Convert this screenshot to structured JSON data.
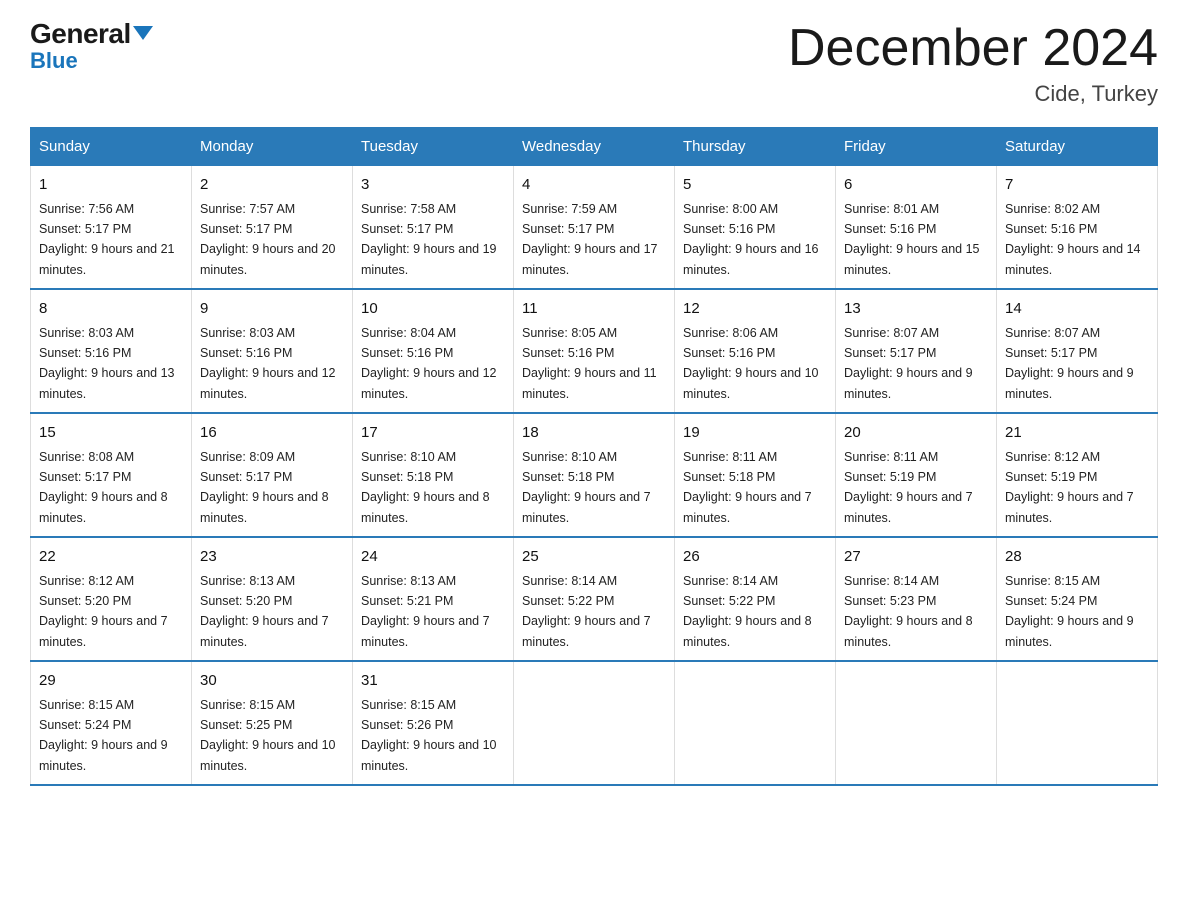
{
  "header": {
    "logo_top": "General",
    "logo_bottom": "Blue",
    "month_title": "December 2024",
    "location": "Cide, Turkey"
  },
  "weekdays": [
    "Sunday",
    "Monday",
    "Tuesday",
    "Wednesday",
    "Thursday",
    "Friday",
    "Saturday"
  ],
  "weeks": [
    [
      {
        "day": "1",
        "sunrise": "7:56 AM",
        "sunset": "5:17 PM",
        "daylight": "9 hours and 21 minutes."
      },
      {
        "day": "2",
        "sunrise": "7:57 AM",
        "sunset": "5:17 PM",
        "daylight": "9 hours and 20 minutes."
      },
      {
        "day": "3",
        "sunrise": "7:58 AM",
        "sunset": "5:17 PM",
        "daylight": "9 hours and 19 minutes."
      },
      {
        "day": "4",
        "sunrise": "7:59 AM",
        "sunset": "5:17 PM",
        "daylight": "9 hours and 17 minutes."
      },
      {
        "day": "5",
        "sunrise": "8:00 AM",
        "sunset": "5:16 PM",
        "daylight": "9 hours and 16 minutes."
      },
      {
        "day": "6",
        "sunrise": "8:01 AM",
        "sunset": "5:16 PM",
        "daylight": "9 hours and 15 minutes."
      },
      {
        "day": "7",
        "sunrise": "8:02 AM",
        "sunset": "5:16 PM",
        "daylight": "9 hours and 14 minutes."
      }
    ],
    [
      {
        "day": "8",
        "sunrise": "8:03 AM",
        "sunset": "5:16 PM",
        "daylight": "9 hours and 13 minutes."
      },
      {
        "day": "9",
        "sunrise": "8:03 AM",
        "sunset": "5:16 PM",
        "daylight": "9 hours and 12 minutes."
      },
      {
        "day": "10",
        "sunrise": "8:04 AM",
        "sunset": "5:16 PM",
        "daylight": "9 hours and 12 minutes."
      },
      {
        "day": "11",
        "sunrise": "8:05 AM",
        "sunset": "5:16 PM",
        "daylight": "9 hours and 11 minutes."
      },
      {
        "day": "12",
        "sunrise": "8:06 AM",
        "sunset": "5:16 PM",
        "daylight": "9 hours and 10 minutes."
      },
      {
        "day": "13",
        "sunrise": "8:07 AM",
        "sunset": "5:17 PM",
        "daylight": "9 hours and 9 minutes."
      },
      {
        "day": "14",
        "sunrise": "8:07 AM",
        "sunset": "5:17 PM",
        "daylight": "9 hours and 9 minutes."
      }
    ],
    [
      {
        "day": "15",
        "sunrise": "8:08 AM",
        "sunset": "5:17 PM",
        "daylight": "9 hours and 8 minutes."
      },
      {
        "day": "16",
        "sunrise": "8:09 AM",
        "sunset": "5:17 PM",
        "daylight": "9 hours and 8 minutes."
      },
      {
        "day": "17",
        "sunrise": "8:10 AM",
        "sunset": "5:18 PM",
        "daylight": "9 hours and 8 minutes."
      },
      {
        "day": "18",
        "sunrise": "8:10 AM",
        "sunset": "5:18 PM",
        "daylight": "9 hours and 7 minutes."
      },
      {
        "day": "19",
        "sunrise": "8:11 AM",
        "sunset": "5:18 PM",
        "daylight": "9 hours and 7 minutes."
      },
      {
        "day": "20",
        "sunrise": "8:11 AM",
        "sunset": "5:19 PM",
        "daylight": "9 hours and 7 minutes."
      },
      {
        "day": "21",
        "sunrise": "8:12 AM",
        "sunset": "5:19 PM",
        "daylight": "9 hours and 7 minutes."
      }
    ],
    [
      {
        "day": "22",
        "sunrise": "8:12 AM",
        "sunset": "5:20 PM",
        "daylight": "9 hours and 7 minutes."
      },
      {
        "day": "23",
        "sunrise": "8:13 AM",
        "sunset": "5:20 PM",
        "daylight": "9 hours and 7 minutes."
      },
      {
        "day": "24",
        "sunrise": "8:13 AM",
        "sunset": "5:21 PM",
        "daylight": "9 hours and 7 minutes."
      },
      {
        "day": "25",
        "sunrise": "8:14 AM",
        "sunset": "5:22 PM",
        "daylight": "9 hours and 7 minutes."
      },
      {
        "day": "26",
        "sunrise": "8:14 AM",
        "sunset": "5:22 PM",
        "daylight": "9 hours and 8 minutes."
      },
      {
        "day": "27",
        "sunrise": "8:14 AM",
        "sunset": "5:23 PM",
        "daylight": "9 hours and 8 minutes."
      },
      {
        "day": "28",
        "sunrise": "8:15 AM",
        "sunset": "5:24 PM",
        "daylight": "9 hours and 9 minutes."
      }
    ],
    [
      {
        "day": "29",
        "sunrise": "8:15 AM",
        "sunset": "5:24 PM",
        "daylight": "9 hours and 9 minutes."
      },
      {
        "day": "30",
        "sunrise": "8:15 AM",
        "sunset": "5:25 PM",
        "daylight": "9 hours and 10 minutes."
      },
      {
        "day": "31",
        "sunrise": "8:15 AM",
        "sunset": "5:26 PM",
        "daylight": "9 hours and 10 minutes."
      },
      null,
      null,
      null,
      null
    ]
  ]
}
